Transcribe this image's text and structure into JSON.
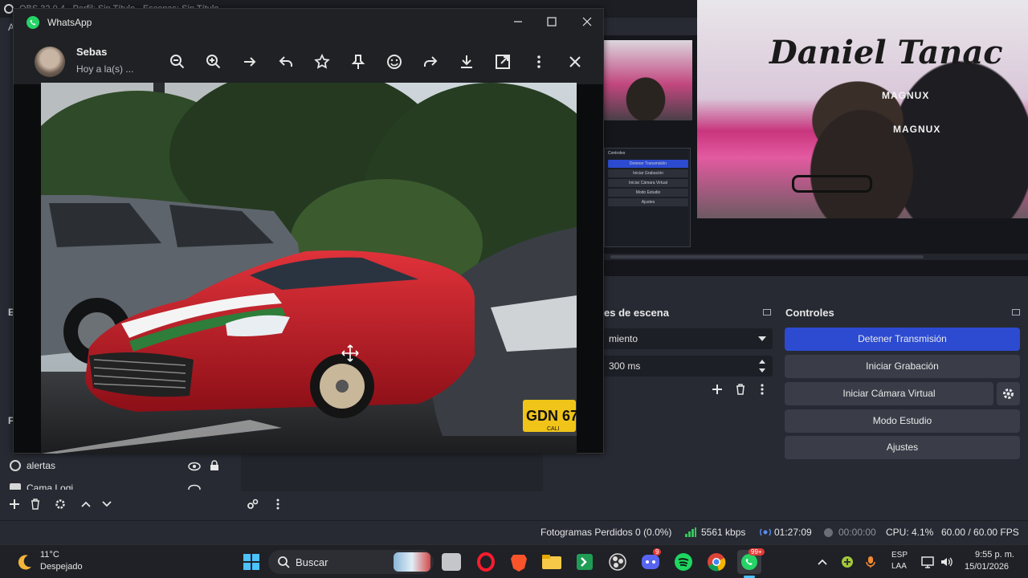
{
  "obs": {
    "title": "OBS 32.0.4 - Perfil: Sin Título - Escenas: Sin Título",
    "left_letter_a": "A",
    "left_letters": [
      "E",
      "F"
    ],
    "scene_transitions": {
      "title_fragment": "es de escena",
      "transition_value": "miento",
      "duration_value": "300 ms"
    },
    "controls": {
      "title": "Controles",
      "buttons": [
        {
          "label": "Detener Transmisión",
          "primary": true
        },
        {
          "label": "Iniciar Grabación",
          "primary": false
        },
        {
          "label": "Iniciar Cámara Virtual",
          "primary": false
        },
        {
          "label": "Modo Estudio",
          "primary": false
        },
        {
          "label": "Ajustes",
          "primary": false
        }
      ]
    },
    "sources": [
      {
        "label": "alertas"
      },
      {
        "label": "Cama Logi"
      }
    ],
    "preview_overlay": {
      "cam_text_1": "MAGNUX",
      "cam_text_2": "MAGNUX",
      "cam_graffiti": "Daniel Tanac",
      "mini_panel_title": "Controles",
      "mini_panel_buttons": [
        "Detener Transmisión",
        "Iniciar Grabación",
        "Iniciar Cámara Virtual",
        "Modo Estudio",
        "Ajustes"
      ]
    },
    "status": {
      "dropped_frames": "Fotogramas Perdidos 0 (0.0%)",
      "bitrate": "5561 kbps",
      "stream_time": "01:27:09",
      "record_time": "00:00:00",
      "cpu": "CPU: 4.1%",
      "fps": "60.00 / 60.00 FPS"
    }
  },
  "whatsapp": {
    "app_title": "WhatsApp",
    "contact_name": "Sebas",
    "contact_status": "Hoy a la(s) ...",
    "toolbar_icons": [
      "zoom-out-icon",
      "zoom-in-icon",
      "arrow-right-icon",
      "reply-icon",
      "star-icon",
      "pin-icon",
      "emoji-icon",
      "forward-icon",
      "download-icon",
      "open-external-icon",
      "more-vert-icon",
      "close-icon"
    ],
    "photo": {
      "plate_text": "GDN 67",
      "plate_city": "CALI"
    }
  },
  "taskbar": {
    "weather_temp": "11°C",
    "weather_desc": "Despejado",
    "search_label": "Buscar",
    "whatsapp_badge": "99+",
    "discord_badge": "9",
    "language": "ESP",
    "language_sub": "LAA",
    "time": "9:55 p. m.",
    "date": "15/01/2026"
  },
  "colors": {
    "obs_bg": "#272a33",
    "primary_button": "#2c4bd1",
    "whatsapp_green": "#25d366",
    "taskbar_bg": "#1f2126"
  }
}
